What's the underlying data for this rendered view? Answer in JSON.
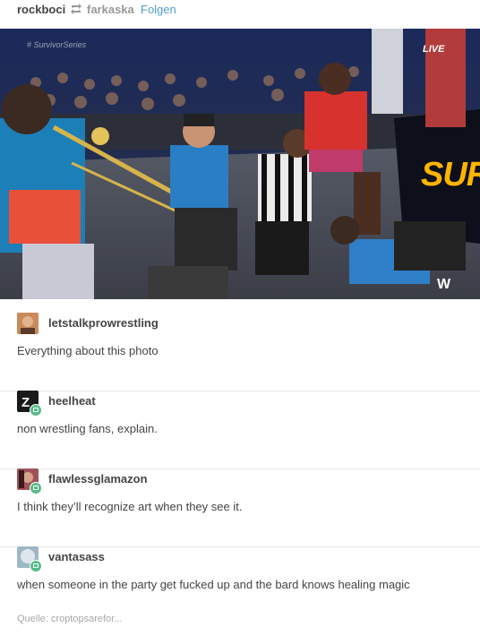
{
  "header": {
    "blog_name": "rockboci",
    "reblog_icon": "reblog-icon",
    "reblogged_from": "farkaska",
    "follow_label": "Folgen"
  },
  "photo": {
    "watermark": "# SurvivorSeries",
    "live_logo": "LIVE",
    "banner_text": "SURV"
  },
  "notes": [
    {
      "username": "letstalkprowrestling",
      "text": "Everything about this photo",
      "avatar_color": "#c98a5a",
      "has_badge": false
    },
    {
      "username": "heelheat",
      "text": "non wrestling fans, explain.",
      "avatar_color": "#1a1a1a",
      "has_badge": true
    },
    {
      "username": "flawlessglamazon",
      "text": "I think they’ll recognize art when they see it.",
      "avatar_color": "#a0525a",
      "has_badge": true
    },
    {
      "username": "vantasass",
      "text": "when someone in the party get fucked up and the bard knows healing magic",
      "avatar_color": "#9fb6c6",
      "has_badge": true
    }
  ],
  "source": {
    "label": "Quelle: croptopsarefor..."
  },
  "colors": {
    "link": "#529ecc",
    "badge": "#56bc8a",
    "text": "#444444",
    "muted": "#a7a7a7"
  }
}
